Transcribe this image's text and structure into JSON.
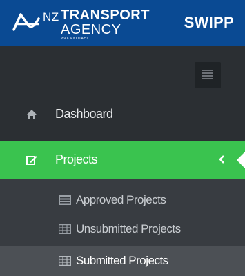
{
  "header": {
    "logo": {
      "nz": "NZ",
      "line1": "TRANSPORT",
      "line2": "AGENCY",
      "tagline": "WAKA KOTAHI"
    },
    "app_name": "SWIPP"
  },
  "sidebar": {
    "toggle_icon": "menu-toggle-icon",
    "items": [
      {
        "label": "Dashboard",
        "icon": "home-icon"
      },
      {
        "label": "Projects",
        "icon": "edit-icon",
        "active": true,
        "expanded": true
      }
    ],
    "submenu": [
      {
        "label": "Approved Projects",
        "icon": "list-icon"
      },
      {
        "label": "Unsubmitted Projects",
        "icon": "grid-icon"
      },
      {
        "label": "Submitted Projects",
        "icon": "grid-icon",
        "selected": true
      }
    ]
  },
  "colors": {
    "header_bg": "#0a4a93",
    "sidebar_bg": "#2b2f33",
    "active_bg": "#3ac34f",
    "submenu_bg": "#383c41"
  }
}
